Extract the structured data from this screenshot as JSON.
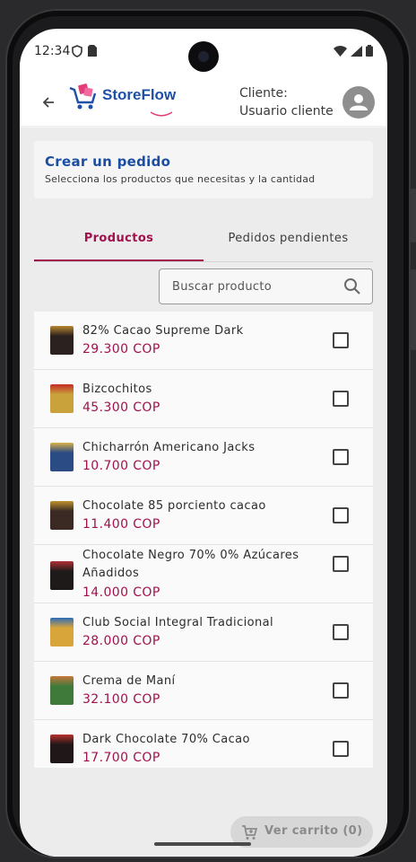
{
  "status": {
    "time": "12:34"
  },
  "app_bar": {
    "logo_text": "StoreFlow",
    "client_label": "Cliente:",
    "client_name": "Usuario cliente"
  },
  "header": {
    "title": "Crear un pedido",
    "subtitle": "Selecciona los productos que necesitas y la cantidad"
  },
  "tabs": [
    {
      "label": "Productos",
      "active": true
    },
    {
      "label": "Pedidos pendientes",
      "active": false
    }
  ],
  "search": {
    "placeholder": "Buscar producto"
  },
  "products": [
    {
      "name": "82% Cacao Supreme Dark",
      "price": "29.300 COP",
      "thumb_color": "#2b2220",
      "accent": "#b8862f"
    },
    {
      "name": "Bizcochitos",
      "price": "45.300 COP",
      "thumb_color": "#c9a23b",
      "accent": "#c42b27"
    },
    {
      "name": "Chicharrón Americano Jacks",
      "price": "10.700 COP",
      "thumb_color": "#2b4b84",
      "accent": "#d9b24a"
    },
    {
      "name": "Chocolate 85 porciento cacao",
      "price": "11.400 COP",
      "thumb_color": "#3b2a24",
      "accent": "#c0912f"
    },
    {
      "name": "Chocolate Negro 70% 0% Azúcares Añadidos",
      "price": "14.000 COP",
      "thumb_color": "#1f1a1a",
      "accent": "#b03035"
    },
    {
      "name": "Club Social Integral Tradicional",
      "price": "28.000 COP",
      "thumb_color": "#d8a53a",
      "accent": "#2e6bb8"
    },
    {
      "name": "Crema de Maní",
      "price": "32.100 COP",
      "thumb_color": "#3f7a3a",
      "accent": "#c8763a"
    },
    {
      "name": "Dark Chocolate 70% Cacao",
      "price": "17.700 COP",
      "thumb_color": "#201818",
      "accent": "#b8302e"
    }
  ],
  "cart": {
    "label": "Ver carrito (0)"
  },
  "colors": {
    "accent": "#a0124d",
    "brand_blue": "#1f4fa6"
  }
}
